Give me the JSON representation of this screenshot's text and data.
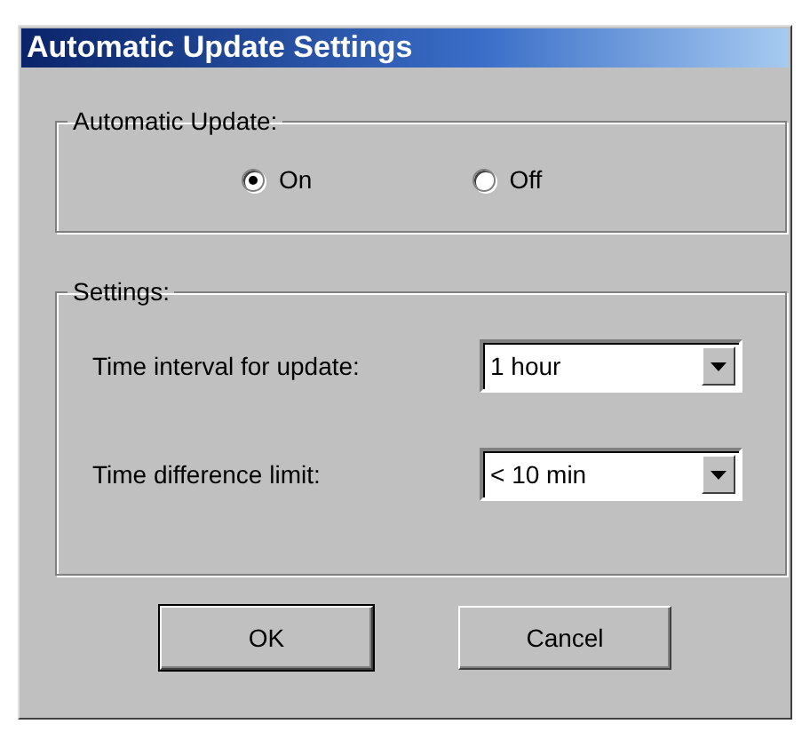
{
  "window": {
    "title": "Automatic Update Settings"
  },
  "automatic_update": {
    "label": "Automatic Update:",
    "options": [
      {
        "label": "On",
        "selected": true
      },
      {
        "label": "Off",
        "selected": false
      }
    ]
  },
  "settings": {
    "label": "Settings:",
    "fields": [
      {
        "label": "Time interval for update:",
        "value": "1 hour"
      },
      {
        "label": "Time difference limit:",
        "value": "< 10 min"
      }
    ]
  },
  "buttons": [
    {
      "label": "OK",
      "default": true
    },
    {
      "label": "Cancel",
      "default": false
    }
  ]
}
